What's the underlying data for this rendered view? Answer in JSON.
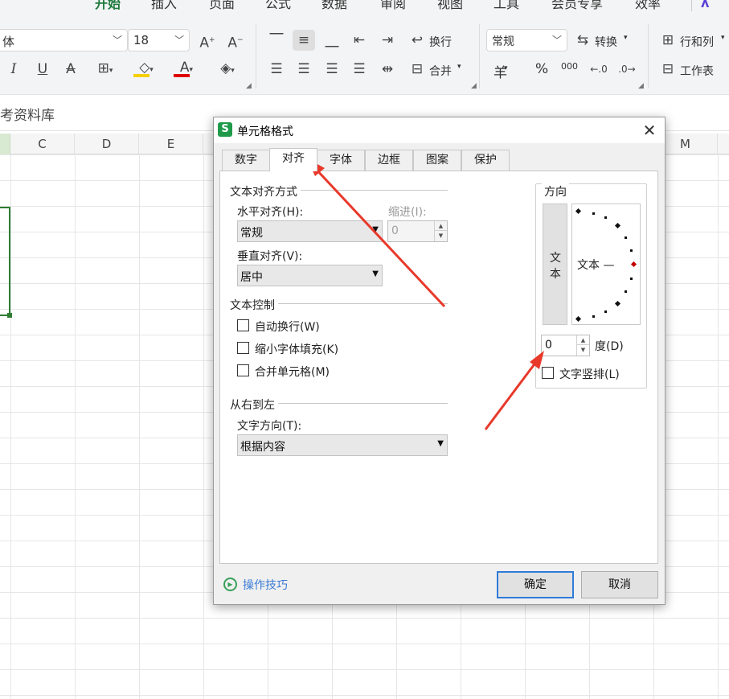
{
  "ribbon": {
    "menu_tabs": [
      "开始",
      "插入",
      "页面",
      "公式",
      "数据",
      "审阅",
      "视图",
      "工具",
      "会员专享",
      "效率"
    ],
    "font_name_partial": "体",
    "font_size": "18",
    "wrap_label": "换行",
    "merge_label": "合并",
    "number_format": "常规",
    "convert_label": "转换",
    "row_col_label": "行和列",
    "worksheet_label": "工作表",
    "currency_symbol": "羊",
    "percent_symbol": "%",
    "thousands_symbol": "000",
    "fill_color": "#f5d000",
    "font_color": "#e00000"
  },
  "formula_bar": {
    "text": "考资料库"
  },
  "grid": {
    "columns": [
      "C",
      "D",
      "E",
      "M"
    ]
  },
  "dialog": {
    "title": "单元格格式",
    "logo": "S",
    "close_glyph": "✕",
    "tabs": [
      "数字",
      "对齐",
      "字体",
      "边框",
      "图案",
      "保护"
    ],
    "text_alignment": {
      "group_label": "文本对齐方式",
      "horizontal_label": "水平对齐(H):",
      "horizontal_value": "常规",
      "indent_label": "缩进(I):",
      "indent_value": "0",
      "vertical_label": "垂直对齐(V):",
      "vertical_value": "居中"
    },
    "text_control": {
      "group_label": "文本控制",
      "wrap_text": "自动换行(W)",
      "shrink_to_fit": "缩小字体填充(K)",
      "merge_cells": "合并单元格(M)"
    },
    "rtl": {
      "group_label": "从右到左",
      "direction_label": "文字方向(T):",
      "direction_value": "根据内容"
    },
    "orientation": {
      "group_label": "方向",
      "vertical_text_chars": [
        "文",
        "本"
      ],
      "dial_label": "文本 —",
      "degrees_value": "0",
      "degrees_label": "度(D)",
      "vertical_text_option": "文字竖排(L)"
    },
    "footer": {
      "tips_label": "操作技巧",
      "ok_label": "确定",
      "cancel_label": "取消"
    }
  },
  "annotation_color": "#e8392b"
}
